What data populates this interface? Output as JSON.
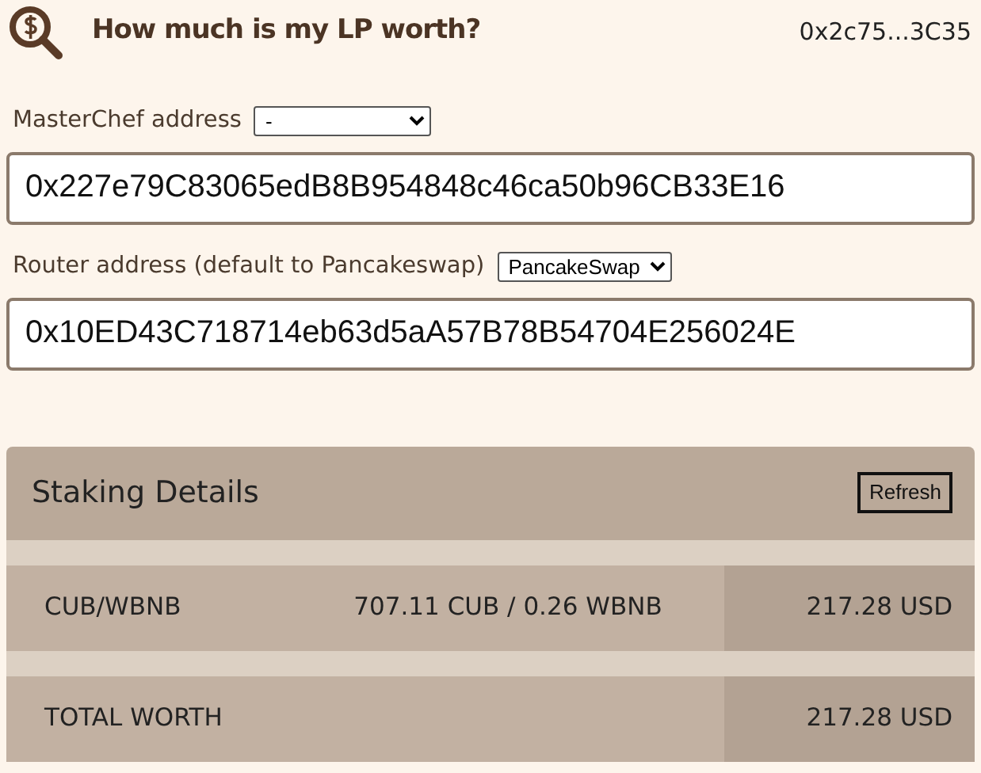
{
  "header": {
    "title": "How much is my LP worth?",
    "account": "0x2c75...3C35"
  },
  "fields": [
    {
      "label": "MasterChef address",
      "select": "-",
      "value": "0x227e79C83065edB8B954848c46ca50b96CB33E16"
    },
    {
      "label": "Router address (default to Pancakeswap)",
      "select": "PancakeSwap",
      "value": "0x10ED43C718714eb63d5aA57B78B54704E256024E"
    }
  ],
  "staking": {
    "title": "Staking Details",
    "button": "Refresh",
    "rows": [
      {
        "name": "CUB/WBNB",
        "amounts": "707.11 CUB / 0.26 WBNB",
        "worth": "217.28 USD"
      },
      {
        "name": "TOTAL WORTH",
        "worth": "217.28 USD"
      }
    ]
  }
}
